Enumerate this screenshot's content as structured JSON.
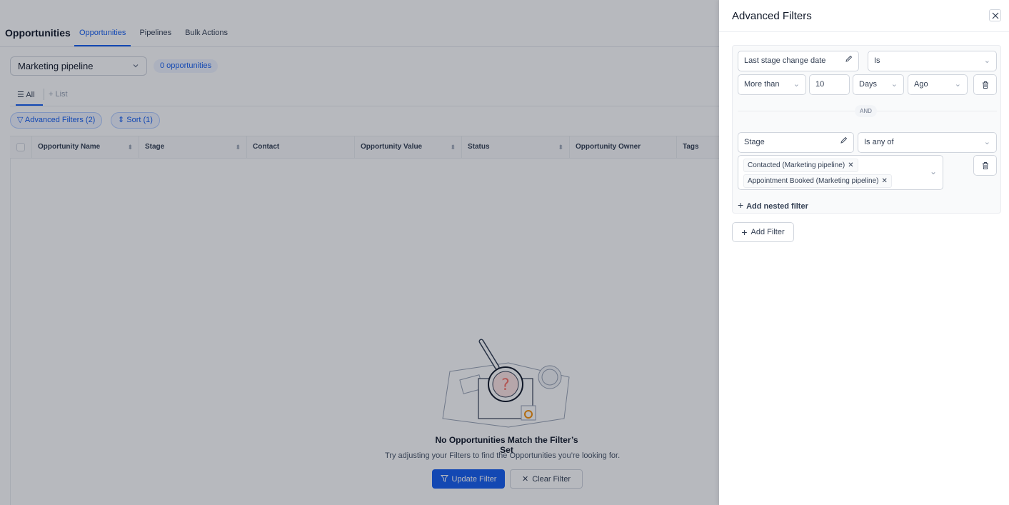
{
  "header": {
    "title": "Opportunities",
    "tabs": [
      {
        "label": "Opportunities",
        "active": true
      },
      {
        "label": "Pipelines",
        "active": false
      },
      {
        "label": "Bulk Actions",
        "active": false
      }
    ]
  },
  "toolbar": {
    "pipeline_value": "Marketing pipeline",
    "count_badge": "0 opportunities"
  },
  "views": {
    "all_label": "All",
    "list_label": "List"
  },
  "chips": {
    "advanced_filters": "Advanced Filters (2)",
    "sort": "Sort (1)"
  },
  "table": {
    "columns": [
      "Opportunity Name",
      "Stage",
      "Contact",
      "Opportunity Value",
      "Status",
      "Opportunity Owner",
      "Tags"
    ]
  },
  "empty_state": {
    "title": "No Opportunities Match the Filter’s Set",
    "subtitle": "Try adjusting your Filters to find the Opportunities you’re looking for.",
    "update_label": "Update Filter",
    "clear_label": "Clear Filter"
  },
  "drawer": {
    "title": "Advanced Filters",
    "filter1": {
      "field": "Last stage change date",
      "operator": "Is",
      "comparator": "More than",
      "amount": "10",
      "unit": "Days",
      "direction": "Ago"
    },
    "connector": "AND",
    "filter2": {
      "field": "Stage",
      "operator": "Is any of",
      "values": [
        "Contacted (Marketing pipeline)",
        "Appointment Booked (Marketing pipeline)"
      ]
    },
    "add_nested_label": "Add nested filter",
    "add_filter_label": "Add Filter"
  },
  "colors": {
    "accent": "#155eef",
    "overlay": "#101828"
  }
}
